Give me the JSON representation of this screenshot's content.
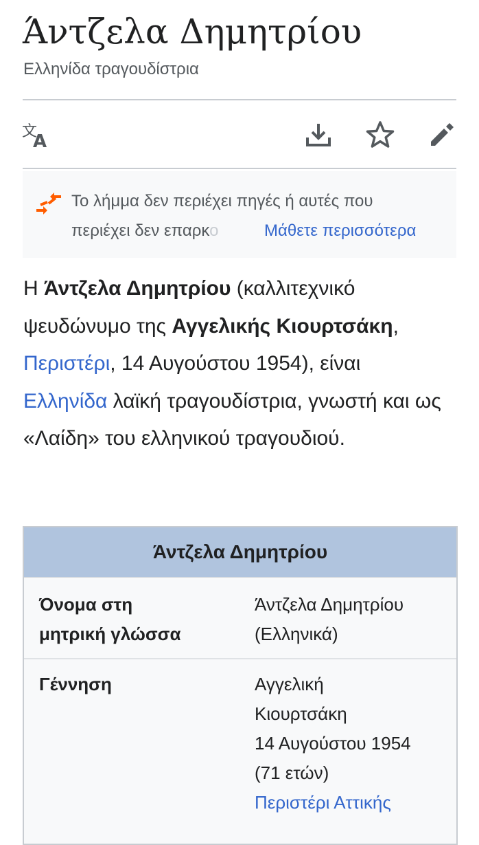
{
  "page": {
    "title": "Άντζελα Δημητρίου",
    "subtitle": "Ελληνίδα τραγουδίστρια"
  },
  "toolbar": {
    "language_icon": "translate-icon",
    "download_icon": "download-icon",
    "watch_icon": "star-icon",
    "edit_icon": "pencil-icon"
  },
  "notice": {
    "line1": "Το λήμμα δεν περιέχει πηγές ή αυτές που",
    "line2_start": "περιέχει δεν επαρκ",
    "line2_fade": "ο",
    "learn_more": "Μάθετε περισσότερα",
    "accent_color": "#fc3",
    "icon_color": "#ff5d00"
  },
  "lead": {
    "w1": "Η ",
    "name": "Άντζελα Δημητρίου",
    "w2": " (καλλιτεχνικό ψευδώνυμο της ",
    "real_name": "Αγγελικής Κιουρτσάκη",
    "w3": ", ",
    "birthplace_link": "Περιστέρι",
    "w4": ", 14 Αυγούστου 1954), είναι ",
    "nationality_link": "Ελληνίδα",
    "w5": " λαϊκή τραγουδίστρια, γνωστή και ως «Λαίδη» του ελληνικού τραγουδιού."
  },
  "infobox": {
    "heading": "Άντζελα Δημητρίου",
    "header_color": "#b0c4de",
    "rows": [
      {
        "label_l1": "Όνομα στη",
        "label_l2": "μητρική γλώσσα",
        "value_l1": "Άντζελα Δημητρίου",
        "value_l2": "(Ελληνικά)"
      },
      {
        "label_l1": "Γέννηση",
        "value_l1": "Αγγελική",
        "value_l2": "Κιουρτσάκη",
        "value_l3": "14 Αυγούστου 1954",
        "value_l4": "(71 ετών)",
        "value_link": "Περιστέρι Αττικής"
      }
    ]
  }
}
